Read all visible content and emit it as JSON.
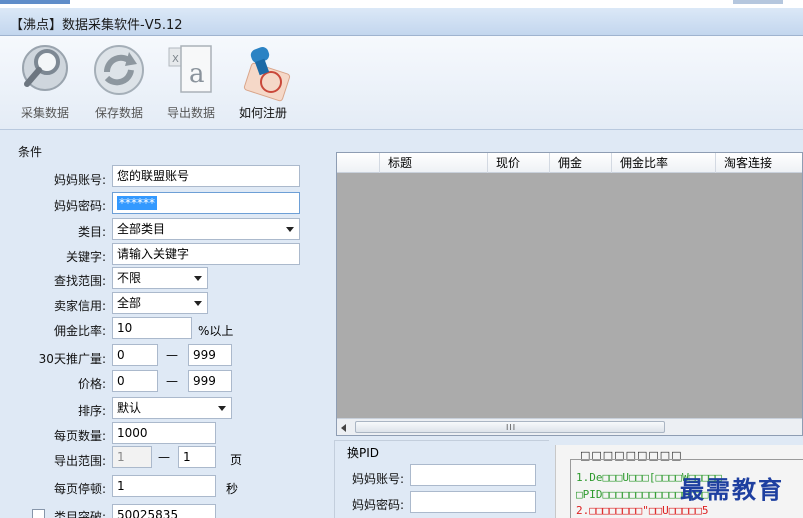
{
  "window": {
    "title": "【沸点】数据采集软件-V5.12"
  },
  "toolbar": {
    "collect": "采集数据",
    "save": "保存数据",
    "export": "导出数据",
    "register": "如何注册"
  },
  "conditions": {
    "group_title": "条件",
    "account_label": "妈妈账号:",
    "account_value": "您的联盟账号",
    "password_label": "妈妈密码:",
    "password_value": "******",
    "category_label": "类目:",
    "category_value": "全部类目",
    "keyword_label": "关键字:",
    "keyword_value": "请输入关键字",
    "scope_label": "查找范围:",
    "scope_value": "不限",
    "credit_label": "卖家信用:",
    "credit_value": "全部",
    "commission_label": "佣金比率:",
    "commission_value": "10",
    "commission_suffix": "%以上",
    "promo_label": "30天推广量:",
    "promo_min": "0",
    "promo_max": "999",
    "price_label": "价格:",
    "price_min": "0",
    "price_max": "999",
    "sort_label": "排序:",
    "sort_value": "默认",
    "perpage_label": "每页数量:",
    "perpage_value": "1000",
    "export_range_label": "导出范围:",
    "export_range_from": "1",
    "export_range_to": "1",
    "export_range_unit": "页",
    "pause_label": "每页停顿:",
    "pause_value": "1",
    "pause_unit": "秒",
    "category_break_label": "类目突破:",
    "category_break_value": "50025835",
    "range_dash": "—"
  },
  "grid": {
    "columns": [
      "标题",
      "现价",
      "佣金",
      "佣金比率",
      "淘客连接"
    ],
    "scroll_grip": "III"
  },
  "pid": {
    "title": "换PID",
    "account_label": "妈妈账号:",
    "password_label": "妈妈密码:"
  },
  "notice": {
    "title": "□□□□□□□□□",
    "line1": "1.De□□□U□□□[□□□□W□□□□□",
    "line2": "□PID□□□□□□□□□□□□□□□□",
    "line3": "2.□□□□□□□□\"□□U□□□□□5"
  },
  "watermark": "最需教育"
}
